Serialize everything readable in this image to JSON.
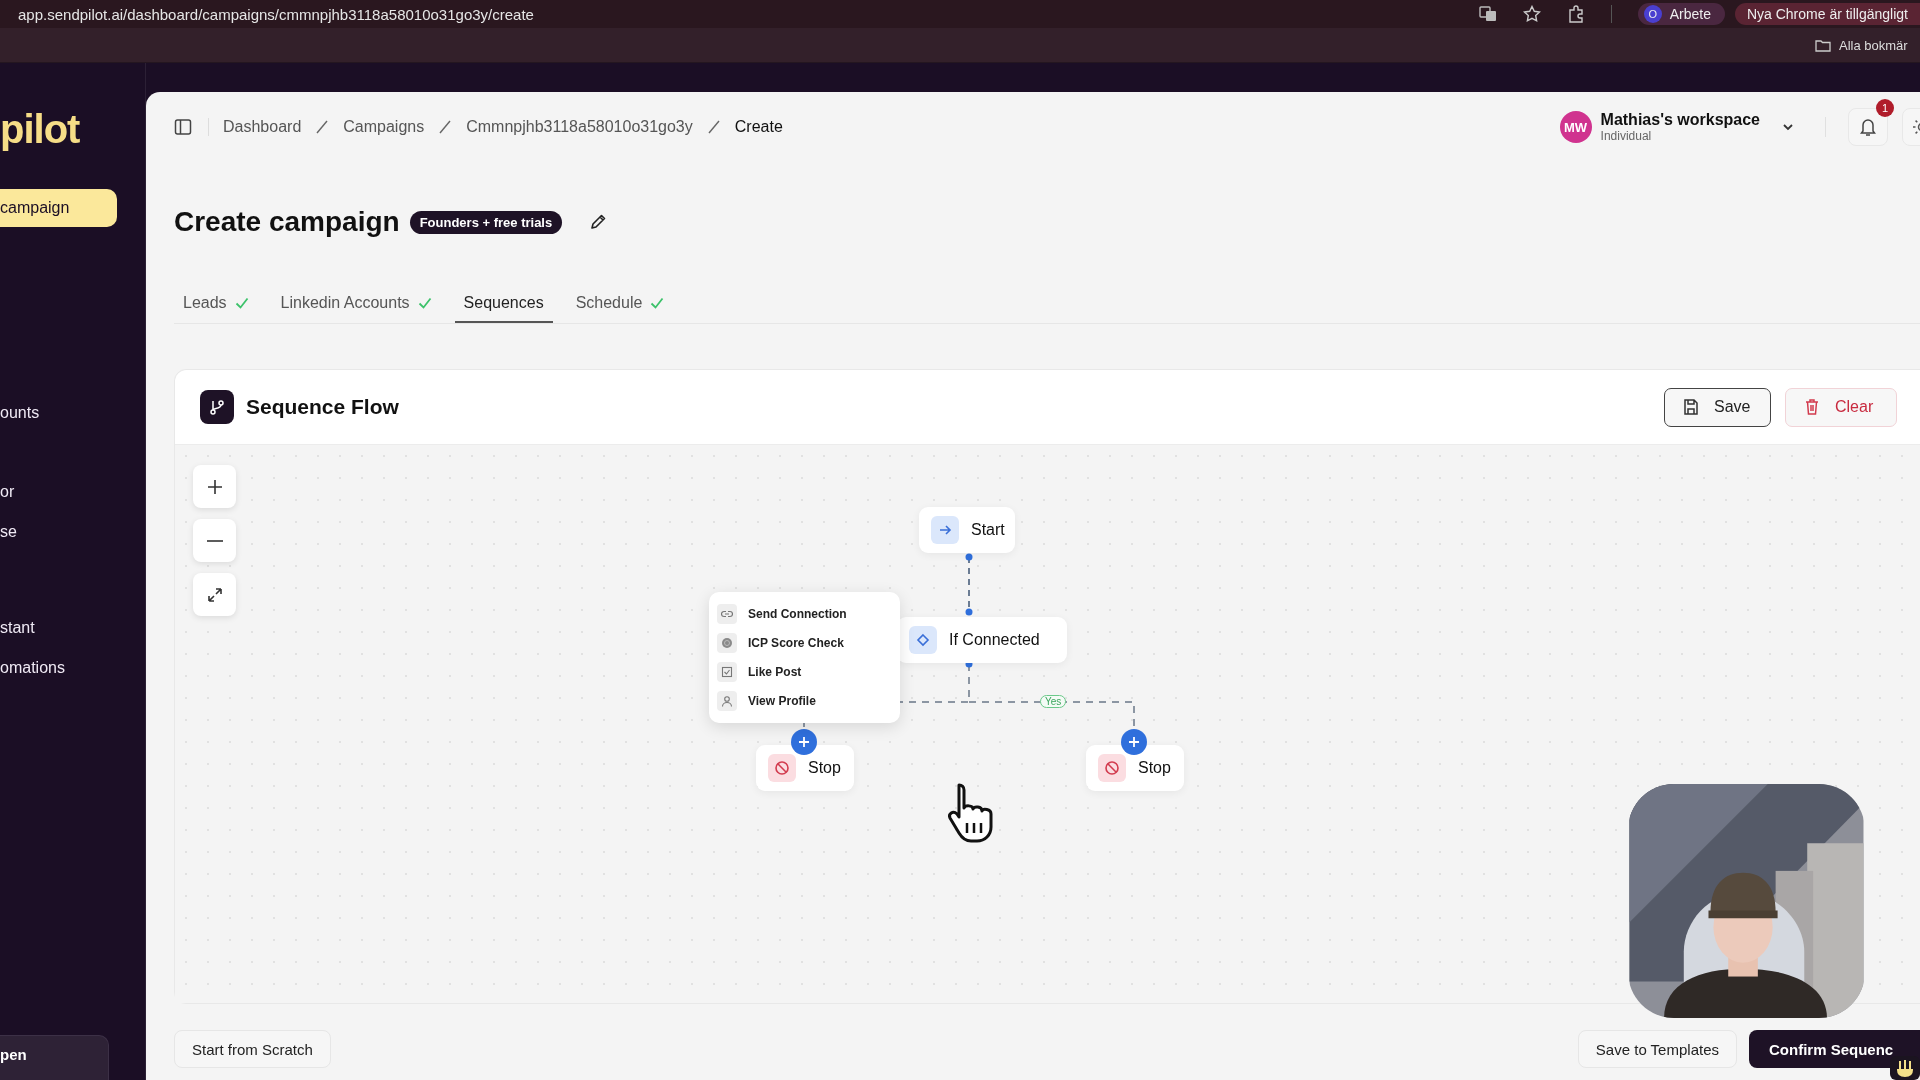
{
  "browser": {
    "url": "app.sendpilot.ai/dashboard/campaigns/cmmnpjhb3118a58010o31go3y/create",
    "profile": {
      "initial": "O",
      "name": "Arbete"
    },
    "update_notice": "Nya Chrome är tillgängligt",
    "bookmarks_folder": "Alla bokmär"
  },
  "sidebar": {
    "logo": "pilot",
    "sections": [
      [
        {
          "label": "campaign",
          "selected": true
        }
      ],
      [
        {
          "label": "ounts",
          "selected": false
        }
      ],
      [
        {
          "label": "or",
          "selected": false
        },
        {
          "label": "se",
          "selected": false
        }
      ],
      [
        {
          "label": "stant",
          "selected": false
        },
        {
          "label": "omations",
          "selected": false
        }
      ]
    ],
    "footer": "pen"
  },
  "breadcrumbs": [
    "Dashboard",
    "Campaigns",
    "Cmmnpjhb3118a58010o31go3y",
    "Create"
  ],
  "workspace": {
    "initials": "MW",
    "name": "Mathias's workspace",
    "plan": "Individual"
  },
  "notifications": {
    "count": "1"
  },
  "title": "Create campaign",
  "badge": "Founders + free trials",
  "tabs": [
    {
      "label": "Leads",
      "completed": true,
      "selected": false
    },
    {
      "label": "Linkedin Accounts",
      "completed": true,
      "selected": false
    },
    {
      "label": "Sequences",
      "completed": false,
      "selected": true
    },
    {
      "label": "Schedule",
      "completed": true,
      "selected": false
    }
  ],
  "flow": {
    "title": "Sequence Flow",
    "actions": [
      {
        "kind": "save",
        "label": "Save"
      },
      {
        "kind": "clear",
        "label": "Clear"
      }
    ],
    "nodes": [
      {
        "kind": "start",
        "label": "Start"
      },
      {
        "kind": "condition",
        "label": "If Connected"
      },
      {
        "kind": "stop",
        "label": "Stop"
      },
      {
        "kind": "stop",
        "label": "Stop"
      }
    ],
    "branch_label": "Yes",
    "menu": [
      {
        "kind": "link",
        "label": "Send Connection"
      },
      {
        "kind": "target",
        "label": "ICP Score Check"
      },
      {
        "kind": "check",
        "label": "Like Post"
      },
      {
        "kind": "person",
        "label": "View Profile"
      }
    ]
  },
  "footer": {
    "start": "Start from Scratch",
    "save": "Save to Templates",
    "confirm": "Confirm Sequenc"
  }
}
